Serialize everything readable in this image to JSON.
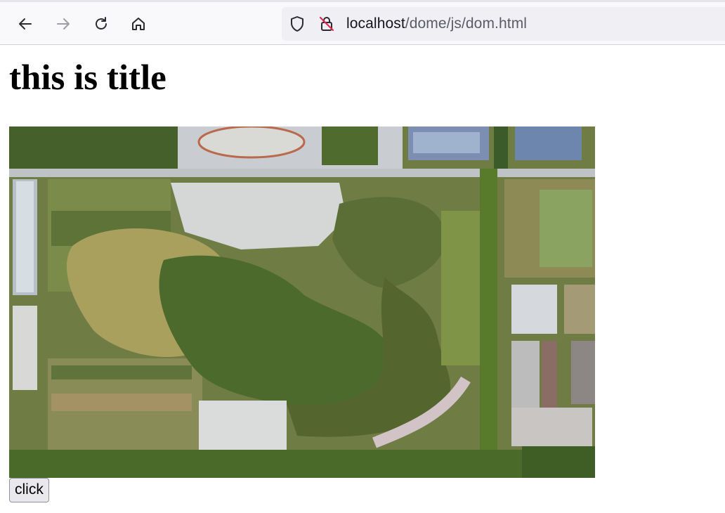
{
  "browser": {
    "url_host": "localhost",
    "url_path": "/dome/js/dom.html"
  },
  "page": {
    "title": "this is title",
    "image_description_icon": "aerial-park-image",
    "button_label": "click"
  }
}
